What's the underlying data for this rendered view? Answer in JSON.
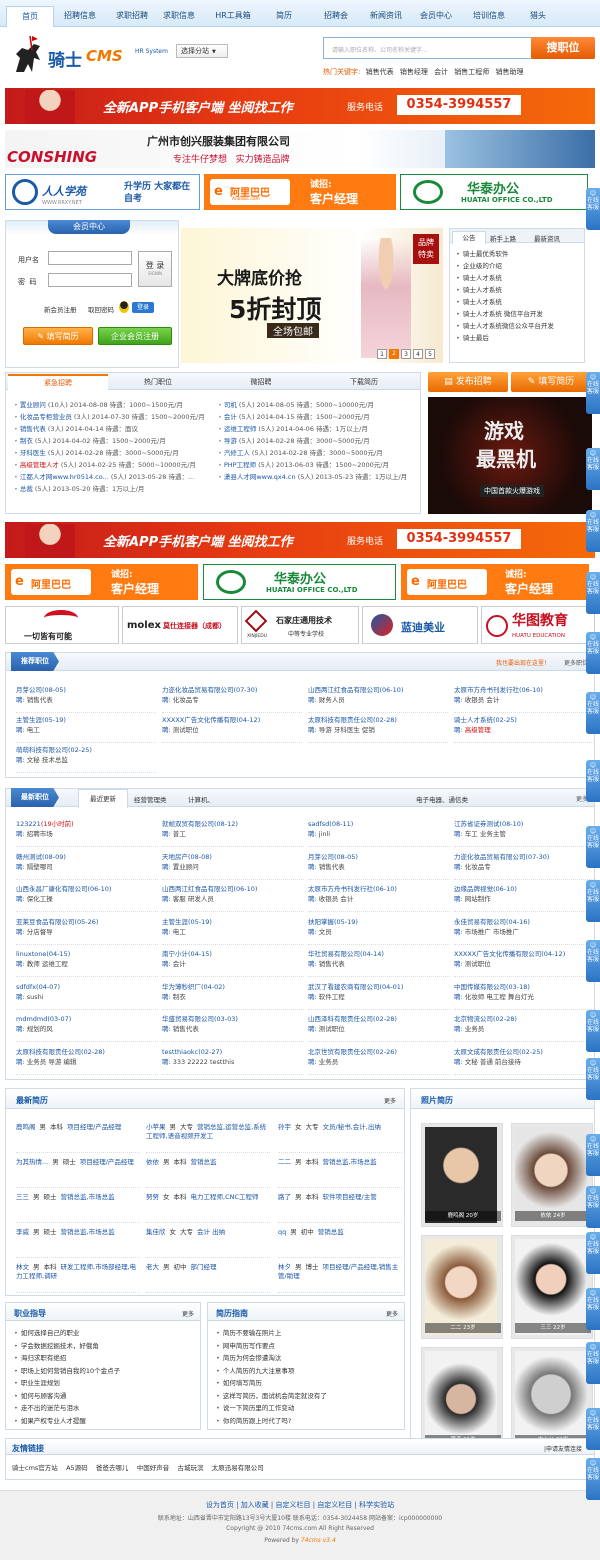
{
  "nav": {
    "home": "首页",
    "items": [
      "招聘信息",
      "求职招聘",
      "求职信息",
      "HR工具箱",
      "简历",
      "招聘会",
      "新闻资讯",
      "会员中心",
      "培训信息",
      "猎头"
    ]
  },
  "header": {
    "logo_text": "骑士",
    "logo_cms": "CMS",
    "logo_sub": "HR System",
    "city_select": "选择分站",
    "search_placeholder": "请输入职位名称、公司名称关键字...",
    "search_button": "搜职位",
    "hot_label": "热门关键字:",
    "hot_keywords": [
      "销售代表",
      "销售经理",
      "会计",
      "销售工程师",
      "销售助理"
    ]
  },
  "banners": {
    "app": {
      "text": "全新APP手机客户端 坐阅找工作",
      "phone_label": "服务电话",
      "phone": "0354-3994557"
    },
    "consing": {
      "brand": "CONSHING",
      "company": "广州市创兴服装集团有限公司",
      "slogan": "专注牛仔梦想   实力铸造品牌"
    },
    "row3": [
      {
        "name": "人人学苑",
        "sub": "升学历 大家都在自考",
        "url": "WWW.RRXY.NET"
      },
      {
        "name": "阿里巴巴",
        "sub1": "诚招:",
        "sub2": "客户经理",
        "url": "Alibaba.com"
      },
      {
        "name": "华泰办公",
        "en": "HUATAI OFFICE CO.,LTD"
      }
    ],
    "promo": {
      "headline1": "大牌底价抢",
      "headline2": "5折封顶",
      "headline3": "全场包邮",
      "badge1": "品牌",
      "badge2": "特卖",
      "pages": [
        "1",
        "2",
        "3",
        "4",
        "5"
      ]
    },
    "mid_app": {
      "text": "全新APP手机客户端 坐阅找工作",
      "phone_label": "服务电话",
      "phone": "0354-3994557"
    },
    "row_mid": [
      {
        "name": "阿里巴巴",
        "sub1": "诚招:",
        "sub2": "客户经理"
      },
      {
        "name": "华泰办公",
        "en": "HUATAI OFFICE CO.,LTD"
      },
      {
        "name": "阿里巴巴",
        "sub1": "诚招:",
        "sub2": "客户经理"
      }
    ],
    "logos": [
      {
        "name": "一切皆有可能"
      },
      {
        "name": "molex",
        "sub": "莫仕连接器（成都）"
      },
      {
        "name": "石家庄通用技术",
        "sub": "中等专业学校",
        "en": "XINJIEDU"
      },
      {
        "name": "蓝迪美业"
      },
      {
        "name": "华图教育",
        "en": "HUATU EDUCATION"
      }
    ],
    "game": {
      "line1": "游戏",
      "line2": "最黑机",
      "sub": "中国首款火爆游戏"
    }
  },
  "member": {
    "title": "会员中心",
    "user_label": "用户名",
    "pwd_label": "密  码",
    "login": "登 录",
    "login_sub": "SIGNIN",
    "register": "新会员注册",
    "forgot": "取回密码",
    "qq_login": "登录",
    "btn_person": "填写简历",
    "btn_company": "企业会员注册"
  },
  "notice": {
    "tabs": [
      "公告",
      "新手上路",
      "最新资讯"
    ],
    "items": [
      "骑士最优秀软件",
      "企业级的介绍",
      "骑士人才系统",
      "骑士人才系统",
      "骑士人才系统",
      "骑士人才系统 微信平台开发",
      "骑士人才系统微信公众平台开发",
      "骑士最后"
    ]
  },
  "jobtabs": {
    "tabs": [
      "紧急招聘",
      "热门职位",
      "微招聘",
      "下载简历"
    ],
    "buttons": [
      "发布招聘",
      "填写简历"
    ]
  },
  "urgent": {
    "left": [
      [
        "置业顾问",
        "(10人) 2014-08-08 待遇：1000~1500元/月"
      ],
      [
        "化妆品专柜营业员",
        "(3人) 2014-07-30 待遇：1500~2000元/月"
      ],
      [
        "销售代表",
        "(3人) 2014-04-14 待遇：面议"
      ],
      [
        "制衣",
        "(5人) 2014-04-02 待遇：1500~2000元/月"
      ],
      [
        "牙科医生",
        "(5人) 2014-02-28 待遇：3000~5000元/月"
      ],
      [
        "高级管理人才",
        "(5人) 2014-02-25 待遇：5000~10000元/月"
      ],
      [
        "江都人才网www.hr0514.co...",
        "(5人) 2013-05-28 待遇：..."
      ],
      [
        "总裁",
        "(5人) 2013-05-20 待遇：1万以上/月"
      ]
    ],
    "right": [
      [
        "司机",
        "(5人) 2014-08-05 待遇：5000~10000元/月"
      ],
      [
        "会计",
        "(5人) 2014-04-15 待遇：1500~2000元/月"
      ],
      [
        "运维工程师",
        "(5人) 2014-04-06 待遇：1万以上/月"
      ],
      [
        "导游",
        "(5人) 2014-02-28 待遇：3000~5000元/月"
      ],
      [
        "汽修工人",
        "(5人) 2014-02-28 待遇：3000~5000元/月"
      ],
      [
        "PHP工程师",
        "(5人) 2013-06-03 待遇：1500~2000元/月"
      ],
      [
        "潇县人才网www.qx4.cn",
        "(5人) 2013-05-23 待遇：1万以上/月"
      ]
    ]
  },
  "recommend": {
    "title": "推荐职位",
    "hint": "我也要出现在这里！",
    "more": "更多职位",
    "items": [
      {
        "co": "月芽公司(08-05)",
        "job": "销售代表"
      },
      {
        "co": "力迩化妆品贸易有限公司(07-30)",
        "job": "化妆品专"
      },
      {
        "co": "山西两江红食品有限公司(06-10)",
        "job": "财务人员"
      },
      {
        "co": "太原市方舟书刊发行社(06-10)",
        "job": "收银员 会计"
      },
      {
        "co": "主管生涯(05-19)",
        "job": "电工"
      },
      {
        "co": "XXXXX广告文化传播有限(04-12)",
        "job": "测试职位"
      },
      {
        "co": "太原科技有限责任公司(02-28)",
        "job": "导游 牙科医生 促销"
      },
      {
        "co": "骑士人才系统(02-25)",
        "job": "高级管理",
        "job_red": true
      },
      {
        "co": "萌萌科技有限公司(02-25)",
        "job": "文秘 技术总监"
      }
    ]
  },
  "latest": {
    "title": "最新职位",
    "tabs": [
      "最近更新",
      "经营管理类",
      "计算机、",
      "电子电器、通信类"
    ],
    "more": "更多",
    "items": [
      {
        "co": "123221(19小时前)",
        "job": "招聘市场",
        "red": true
      },
      {
        "co": "就帧双贸有限公司(08-12)",
        "job": "普工"
      },
      {
        "co": "sadfsd(08-11)",
        "job": "jinli"
      },
      {
        "co": "江苏省证券测试(08-10)",
        "job": "车工 业务主管"
      },
      {
        "co": "赣州测试(08-09)",
        "job": "隔壁哪司"
      },
      {
        "co": "天地房产(08-08)",
        "job": "置业顾问"
      },
      {
        "co": "月芽公司(08-05)",
        "job": "销售代表"
      },
      {
        "co": "力迩化妆品贸易有限公司(07-30)",
        "job": "化妆品专"
      },
      {
        "co": "山西永昌厂康化有限公司(06-10)",
        "job": "保化工操"
      },
      {
        "co": "山西两江红食品有限公司(06-10)",
        "job": "客服 研发人员"
      },
      {
        "co": "太原市方舟书刊发行社(06-10)",
        "job": "收银员 会计"
      },
      {
        "co": "边缘品牌视觉(06-10)",
        "job": "网站制作"
      },
      {
        "co": "亚莱豆食品有限公司(05-26)",
        "job": "分店督导"
      },
      {
        "co": "主管生涯(05-19)",
        "job": "电工"
      },
      {
        "co": "扶阳掌握(05-19)",
        "job": "文员"
      },
      {
        "co": "永佳贸易有限公司(04-16)",
        "job": "市场推广 市场推广"
      },
      {
        "co": "linuxtone(04-15)",
        "job": "教师 运维工程"
      },
      {
        "co": "南宁小计(04-15)",
        "job": "会计"
      },
      {
        "co": "华社贸易有限公司(04-14)",
        "job": "销售代表"
      },
      {
        "co": "XXXXX广告文化传播有限公司(04-12)",
        "job": "测试职位"
      },
      {
        "co": "sdfdfx(04-07)",
        "job": "sushi"
      },
      {
        "co": "华为薄秒织厂(04-02)",
        "job": "制衣"
      },
      {
        "co": "武汉了看建农商有限公司(04-01)",
        "job": "软件工程"
      },
      {
        "co": "中国传媒有限公司(03-18)",
        "job": "化妆师 电工程 舞台灯光"
      },
      {
        "co": "mdmdmd(03-07)",
        "job": "规划的风"
      },
      {
        "co": "华盛贸易有限公司(03-03)",
        "job": "销售代表"
      },
      {
        "co": "山西泽科有限责任公司(02-28)",
        "job": "测试职位"
      },
      {
        "co": "北京物流公司(02-28)",
        "job": "业务员"
      },
      {
        "co": "太原科技有限责任公司(02-28)",
        "job": "业务员 导游 编辑"
      },
      {
        "co": "testthiaokc(02-27)",
        "job": "333 22222 testthis"
      },
      {
        "co": "北京世贸有限责任公司(02-26)",
        "job": "业务员"
      },
      {
        "co": "太原文成有限责任公司(02-25)",
        "job": "文秘 普通 前台接待"
      }
    ]
  },
  "resumes": {
    "title": "最新简历",
    "more": "更多",
    "items": [
      {
        "name": "鹿鸣阁",
        "g": "男",
        "edu": "本科",
        "job": "项目经理/产品经理"
      },
      {
        "name": "小苹果",
        "g": "男",
        "edu": "大专",
        "job": "营销总监,运营总监,系统工程师,语音视频开发工"
      },
      {
        "name": "孙宇",
        "g": "女",
        "edu": "大专",
        "job": "文员/秘书,会计,出纳"
      },
      {
        "name": "为其热情...",
        "g": "男",
        "edu": "硕士",
        "job": "项目经理/产品经理"
      },
      {
        "name": "依依",
        "g": "男",
        "edu": "本科",
        "job": "营销总监"
      },
      {
        "name": "二二",
        "g": "男",
        "edu": "本科",
        "job": "营销总监,市场总监"
      },
      {
        "name": "三三",
        "g": "男",
        "edu": "硕士",
        "job": "营销总监,市场总监"
      },
      {
        "name": "努努",
        "g": "女",
        "edu": "本科",
        "job": "电力工程师,CNC工程师"
      },
      {
        "name": "路了",
        "g": "男",
        "edu": "本科",
        "job": "软件项目经理/主管"
      },
      {
        "name": "李威",
        "g": "男",
        "edu": "硕士",
        "job": "营销总监,市场总监"
      },
      {
        "name": "集佳欣",
        "g": "女",
        "edu": "大专",
        "job": "会计 出纳"
      },
      {
        "name": "qq",
        "g": "男",
        "edu": "初中",
        "job": "营销总监"
      },
      {
        "name": "林文",
        "g": "男",
        "edu": "本科",
        "job": "研发工程师,市场部经理,电力工程师,调研"
      },
      {
        "name": "老大",
        "g": "男",
        "edu": "初中",
        "job": "部门经理"
      },
      {
        "name": "林夕",
        "g": "男",
        "edu": "博士",
        "job": "项目经理/产品经理,销售主管/助理"
      }
    ]
  },
  "photos": {
    "title": "照片简历",
    "caps": [
      "鹿鸣阁 20岁",
      "依依 24岁",
      "二二 23岁",
      "三三 22岁",
      "周者 21岁",
      "大山公 22岁"
    ]
  },
  "guide": {
    "title": "职业指导",
    "more": "更多",
    "items": [
      "如何选择自己的职业",
      "学会数据挖掘技术，好俄角",
      "海归求职有绝招",
      "职场上如何营销自我的10个金点子",
      "职业生涯规划",
      "如何与顾客沟通",
      "走不出的迷茫与泪水",
      "如果产权专业人才提醒"
    ]
  },
  "tips": {
    "title": "简历指南",
    "more": "更多",
    "items": [
      "简历不要输在照片上",
      "网申简历写作要点",
      "简历为何会惨遭淘汰",
      "个人简历的九大注意事项",
      "如何填写简历",
      "这样写简历，面试机会简定就没有了",
      "说一下简历里的工作变动",
      "你的简历跟上时代了吗?"
    ]
  },
  "links": {
    "title": "友情链接",
    "apply": "|申请友情连接",
    "items": [
      "骑士cms官方站",
      "A5源码",
      "爸爸去哪儿",
      "中国好声音",
      "古城玩滨",
      "太原迅易有限公司"
    ]
  },
  "footer": {
    "links": [
      "设为首页",
      "加入收藏",
      "自定义栏目",
      "自定义栏目",
      "科学实验站"
    ],
    "address": "联系地址：山西省晋中市定阳路13号3号大厦10楼 联系电话：0354-3024458 网站备案：icp000000000",
    "copyright": "Copyright @ 2010 74cms.com All Right Reserved",
    "powered": "Powered by",
    "powered_brand": "74cms v3.4"
  },
  "side": {
    "label_top": "在线",
    "label_bot": "客服"
  }
}
